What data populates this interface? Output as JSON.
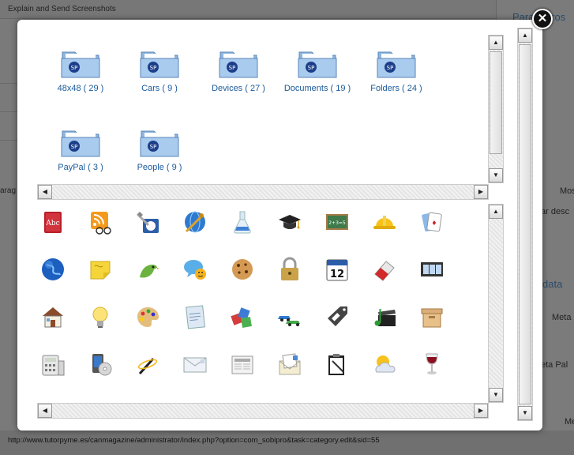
{
  "background": {
    "page_title": "Explain and Send Screenshots",
    "status_url": "http://www.tutorpyme.es/canmagazine/administrator/index.php?option=com_sobipro&task=category.edit&sid=55",
    "left_fragment": "arag",
    "right_heading_1": "Parametros",
    "right_heading_2": "data",
    "right_label_1": "Mos",
    "right_label_2": "ar desc",
    "right_label_3": "Meta",
    "right_label_4": "eta Pal",
    "right_label_5": "Me"
  },
  "modal": {
    "close_label": "✕",
    "folders": [
      {
        "label": "48x48 ( 29 )",
        "icon": "folder-icon"
      },
      {
        "label": "Cars ( 9 )",
        "icon": "folder-icon"
      },
      {
        "label": "Devices ( 27 )",
        "icon": "folder-icon"
      },
      {
        "label": "Documents ( 19 )",
        "icon": "folder-icon"
      },
      {
        "label": "Folders ( 24 )",
        "icon": "folder-icon"
      },
      {
        "label": "PayPal ( 3 )",
        "icon": "folder-icon"
      },
      {
        "label": "People ( 9 )",
        "icon": "folder-icon"
      }
    ],
    "icons": [
      "address-book-icon",
      "rss-glasses-icon",
      "network-tools-icon",
      "globe-tools-icon",
      "flask-icon",
      "graduation-cap-icon",
      "chalkboard-icon",
      "hard-hat-icon",
      "playing-cards-icon",
      "globe-icon",
      "sticky-note-icon",
      "bird-icon",
      "chat-smiley-icon",
      "cookie-icon",
      "padlock-icon",
      "calendar-icon",
      "eraser-icon",
      "film-strip-icon",
      "house-icon",
      "lightbulb-icon",
      "paint-palette-icon",
      "notepad-icon",
      "puzzle-icon",
      "cars-icon",
      "price-tag-icon",
      "music-clapper-icon",
      "wooden-box-icon",
      "calculator-icon",
      "phone-disc-icon",
      "magic-wand-icon",
      "envelope-icon",
      "newspaper-icon",
      "mail-letter-icon",
      "clipboard-pen-icon",
      "weather-sun-cloud-icon",
      "wine-glass-icon"
    ],
    "calendar_day": "12"
  }
}
